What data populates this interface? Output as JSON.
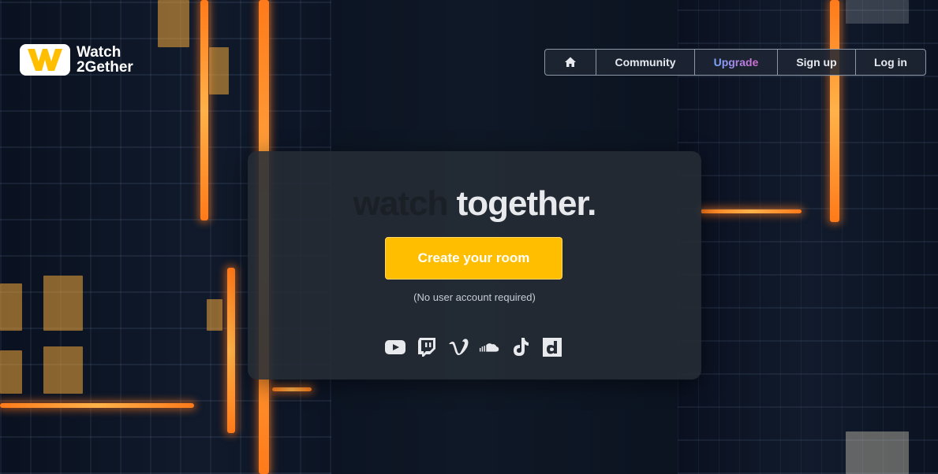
{
  "brand": {
    "line1": "Watch",
    "line2": "2Gether"
  },
  "nav": {
    "home_icon": "home-icon",
    "community": "Community",
    "upgrade": "Upgrade",
    "signup": "Sign up",
    "login": "Log in"
  },
  "hero": {
    "headline_a": "watch",
    "headline_b": "together.",
    "cta": "Create your room",
    "note": "(No user account required)"
  },
  "services": [
    "youtube-icon",
    "twitch-icon",
    "vimeo-icon",
    "soundcloud-icon",
    "tiktok-icon",
    "dailymotion-icon"
  ],
  "colors": {
    "cta": "#ffbf00",
    "accent_neon": "#ff8a2a",
    "card": "#262c36"
  }
}
